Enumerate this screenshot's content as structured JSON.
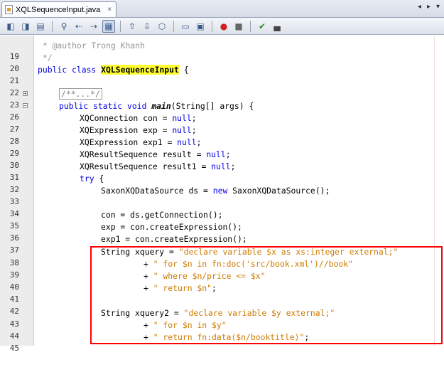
{
  "tab": {
    "title": "XQLSequenceInput.java",
    "close": "×",
    "nav_left": "◂",
    "nav_right": "▸",
    "menu": "▾"
  },
  "toolbar": {
    "icons": [
      "back-icon",
      "forward-icon",
      "history-icon",
      "find-icon",
      "find-prev-icon",
      "find-next-icon",
      "toggle-highlight-icon",
      "shift-left-icon",
      "shift-right-icon",
      "bookmarks-icon",
      "comment-icon",
      "uncomment-icon",
      "record-macro-icon",
      "stop-macro-icon",
      "run-icon",
      "edit-icon"
    ]
  },
  "code": {
    "l19": {
      "n": "19",
      "t": " * @author Trong Khanh"
    },
    "l20": {
      "n": "20",
      "t": " */"
    },
    "l21": {
      "n": "21",
      "a": "public class ",
      "b": "XQLSequenceInput",
      "c": " {"
    },
    "l22": {
      "n": "22"
    },
    "l23": {
      "n": "23",
      "t": "/**...*/"
    },
    "l26": {
      "n": "26",
      "a": "public static void ",
      "b": "main",
      "c": "(String[] args) {"
    },
    "l27": {
      "n": "27",
      "a": "XQConnection con = ",
      "b": "null",
      "c": ";"
    },
    "l28": {
      "n": "28",
      "a": "XQExpression exp = ",
      "b": "null",
      "c": ";"
    },
    "l29": {
      "n": "29",
      "a": "XQExpression exp1 = ",
      "b": "null",
      "c": ";"
    },
    "l30": {
      "n": "30",
      "a": "XQResultSequence result = ",
      "b": "null",
      "c": ";"
    },
    "l31": {
      "n": "31",
      "a": "XQResultSequence result1 = ",
      "b": "null",
      "c": ";"
    },
    "l32": {
      "n": "32",
      "a": "try",
      "c": " {"
    },
    "l33": {
      "n": "33",
      "a": "SaxonXQDataSource ds = ",
      "b": "new",
      "c": " SaxonXQDataSource();"
    },
    "l34": {
      "n": "34"
    },
    "l35": {
      "n": "35",
      "t": "con = ds.getConnection();"
    },
    "l36": {
      "n": "36",
      "t": "exp = con.createExpression();"
    },
    "l37": {
      "n": "37",
      "t": "exp1 = con.createExpression();"
    },
    "l38": {
      "n": "38",
      "a": "String xquery = ",
      "b": "\"declare variable $x as xs:integer external;\""
    },
    "l39": {
      "n": "39",
      "a": "+ ",
      "b": "\" for $n in fn:doc('src/book.xml')//book\""
    },
    "l40": {
      "n": "40",
      "a": "+ ",
      "b": "\" where $n/price <= $x\""
    },
    "l41": {
      "n": "41",
      "a": "+ ",
      "b": "\" return $n\"",
      "c": ";"
    },
    "l42": {
      "n": "42"
    },
    "l43": {
      "n": "43",
      "a": "String xquery2 = ",
      "b": "\"declare variable $y external;\""
    },
    "l44": {
      "n": "44",
      "a": "+ ",
      "b": "\" for $n in $y\""
    },
    "l45": {
      "n": "45",
      "a": "+ ",
      "b": "\" return fn:data($n/booktitle)\"",
      "c": ";"
    }
  }
}
